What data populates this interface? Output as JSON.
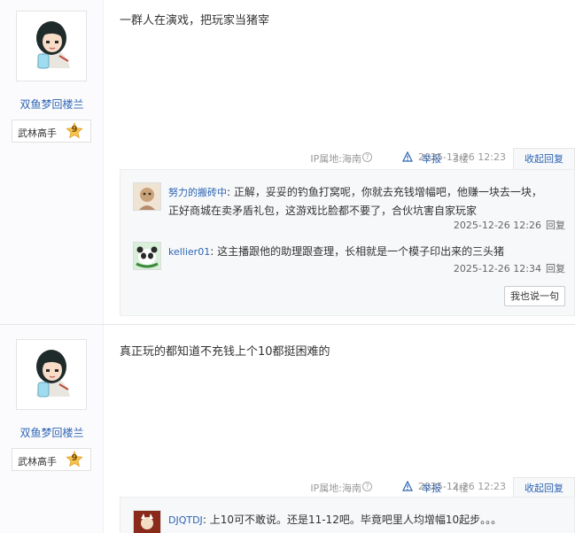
{
  "posts": [
    {
      "author": {
        "name": "双鱼梦回楼兰",
        "badge_title": "武林高手",
        "level": "9"
      },
      "content": "一群人在演戏，把玩家当猪宰",
      "tail": {
        "ip": "IP属地:海南",
        "report": "举报",
        "floor": "3楼",
        "time": "2025-12-26 12:23",
        "fold": "收起回复"
      },
      "replies": [
        {
          "user": "努力的搬砖中",
          "text_line1": "正解，妥妥的钓鱼打窝呢，你就去充钱增幅吧，他赚一块去一块，",
          "text_line2": "正好商城在卖矛盾礼包，这游戏比脸都不要了，合伙坑害自家玩家",
          "time": "2025-12-26 12:26",
          "reply": "回复"
        },
        {
          "user": "kellier01",
          "text_line1": "这主播跟他的助理跟查理，长相就是一个模子印出来的三头猪",
          "time": "2025-12-26 12:34",
          "reply": "回复"
        }
      ],
      "say_button": "我也说一句"
    },
    {
      "author": {
        "name": "双鱼梦回楼兰",
        "badge_title": "武林高手",
        "level": "9"
      },
      "content": "真正玩的都知道不充钱上个10都挺困难的",
      "tail": {
        "ip": "IP属地:海南",
        "report": "举报",
        "floor": "4楼",
        "time": "2025-12-26 12:23",
        "fold": "收起回复"
      },
      "replies": [
        {
          "user": "DJQTDJ",
          "text_line1": "上10可不敢说。还是11-12吧。毕竟吧里人均增幅10起步。。。"
        }
      ]
    }
  ],
  "colors": {
    "link": "#2d64b3",
    "muted": "#999999",
    "lzl_bg": "#f7f8fa"
  },
  "separator": ":",
  "help_icon_glyph": "?"
}
